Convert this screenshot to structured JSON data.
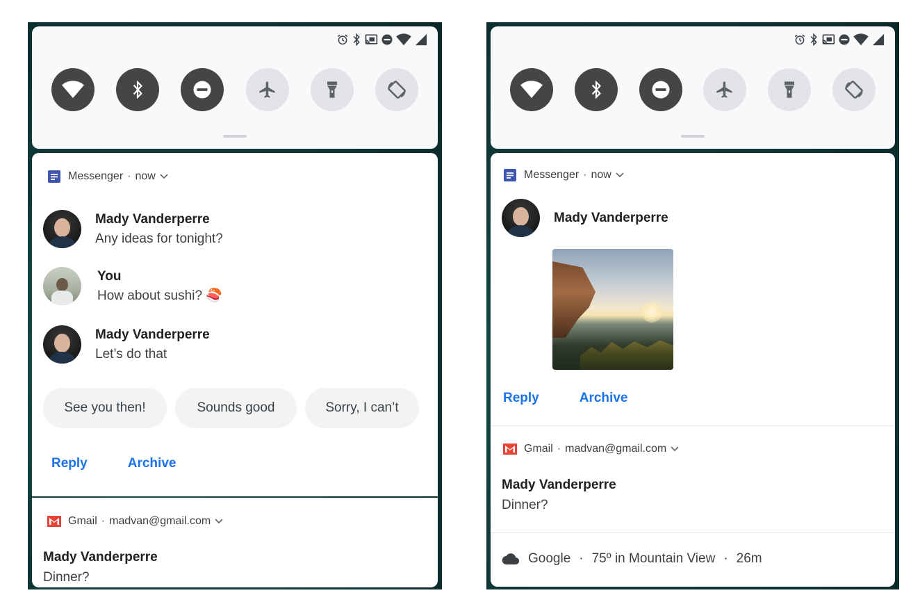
{
  "colors": {
    "action_blue": "#1a73e8",
    "tile_on": "#454545",
    "tile_off": "#e3e4e8",
    "messenger_blue": "#4054b2",
    "gmail_red": "#ea4335"
  },
  "quick_settings": {
    "status_icons": [
      "alarm-icon",
      "bluetooth-icon",
      "cast-icon",
      "do-not-disturb-icon",
      "wifi-icon",
      "cell-signal-icon"
    ],
    "tiles": [
      {
        "name": "wifi",
        "icon": "wifi-icon",
        "state": "on"
      },
      {
        "name": "bluetooth",
        "icon": "bluetooth-icon",
        "state": "on"
      },
      {
        "name": "do-not-disturb",
        "icon": "do-not-disturb-icon",
        "state": "on"
      },
      {
        "name": "airplane-mode",
        "icon": "airplane-icon",
        "state": "off"
      },
      {
        "name": "flashlight",
        "icon": "flashlight-icon",
        "state": "off"
      },
      {
        "name": "auto-rotate",
        "icon": "auto-rotate-icon",
        "state": "off"
      }
    ]
  },
  "left": {
    "messenger": {
      "app": "Messenger",
      "time": "now",
      "messages": [
        {
          "sender": "Mady Vanderperre",
          "text": "Any ideas for tonight?"
        },
        {
          "sender": "You",
          "text": "How about sushi? 🍣"
        },
        {
          "sender": "Mady Vanderperre",
          "text": "Let’s do that"
        }
      ],
      "smart_replies": [
        "See you then!",
        "Sounds good",
        "Sorry, I can’t"
      ],
      "actions": {
        "reply": "Reply",
        "archive": "Archive"
      }
    },
    "gmail": {
      "app": "Gmail",
      "account": "madvan@gmail.com",
      "sender": "Mady Vanderperre",
      "subject": "Dinner?"
    }
  },
  "right": {
    "messenger": {
      "app": "Messenger",
      "time": "now",
      "sender": "Mady Vanderperre",
      "actions": {
        "reply": "Reply",
        "archive": "Archive"
      }
    },
    "gmail": {
      "app": "Gmail",
      "account": "madvan@gmail.com",
      "sender": "Mady Vanderperre",
      "subject": "Dinner?"
    },
    "google": {
      "app": "Google",
      "weather": "75º in Mountain View",
      "time": "26m"
    }
  },
  "separator": "·"
}
